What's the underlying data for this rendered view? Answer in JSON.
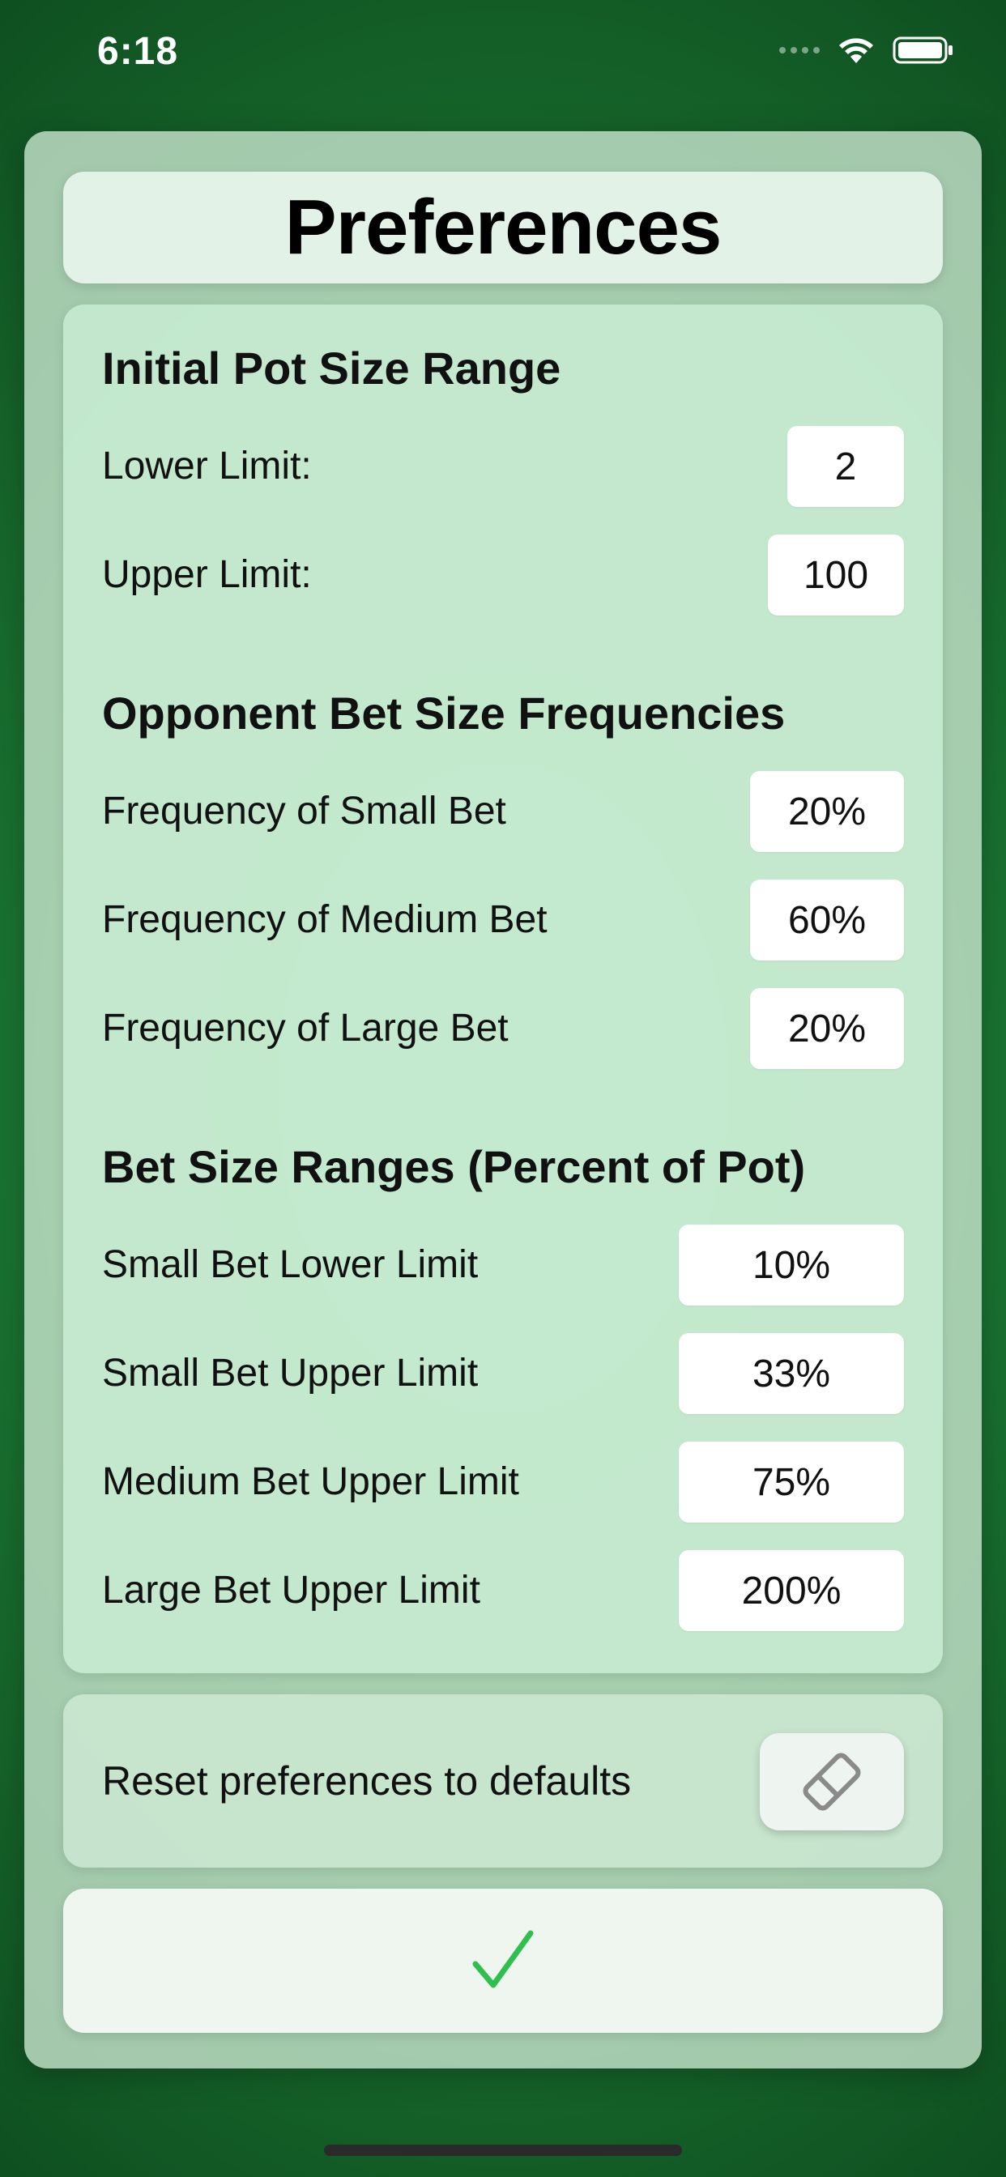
{
  "status_bar": {
    "time": "6:18",
    "icons": [
      "signal-icon",
      "wifi-icon",
      "battery-icon"
    ]
  },
  "header": {
    "title": "Preferences"
  },
  "pot_size": {
    "title": "Initial Pot Size Range",
    "rows": [
      {
        "label": "Lower Limit:",
        "value": "2"
      },
      {
        "label": "Upper Limit:",
        "value": "100"
      }
    ]
  },
  "opponent_freq": {
    "title": "Opponent Bet Size Frequencies",
    "rows": [
      {
        "label": "Frequency of Small Bet",
        "value": "20%"
      },
      {
        "label": "Frequency of Medium Bet",
        "value": "60%"
      },
      {
        "label": "Frequency of Large Bet",
        "value": "20%"
      }
    ]
  },
  "bet_ranges": {
    "title": "Bet Size Ranges (Percent of Pot)",
    "rows": [
      {
        "label": "Small Bet Lower Limit",
        "value": "10%"
      },
      {
        "label": "Small Bet Upper Limit",
        "value": "33%"
      },
      {
        "label": "Medium Bet Upper Limit",
        "value": "75%"
      },
      {
        "label": "Large Bet Upper Limit",
        "value": "200%"
      }
    ]
  },
  "reset": {
    "label": "Reset preferences to defaults",
    "icon": "eraser-icon"
  },
  "confirm": {
    "icon": "checkmark-icon"
  },
  "colors": {
    "background": "#1c7a35",
    "panel": "#cde8d2",
    "field": "#ffffff",
    "checkmark": "#2fbf4f"
  }
}
